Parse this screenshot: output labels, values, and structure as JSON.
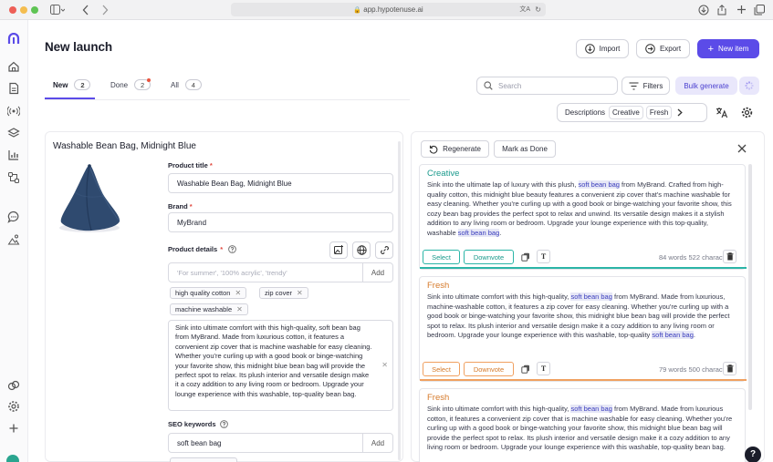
{
  "browser": {
    "url": "app.hypotenuse.ai"
  },
  "header": {
    "title": "New launch",
    "import_label": "Import",
    "export_label": "Export",
    "new_item_label": "New item"
  },
  "tabs": [
    {
      "label": "New",
      "count": "2"
    },
    {
      "label": "Done",
      "count": "2"
    },
    {
      "label": "All",
      "count": "4"
    }
  ],
  "toolbar": {
    "search_placeholder": "Search",
    "filters_label": "Filters",
    "bulk_label": "Bulk generate",
    "descriptions_label": "Descriptions",
    "desc_chip_1": "Creative",
    "desc_chip_2": "Fresh"
  },
  "product": {
    "name": "Washable Bean Bag, Midnight Blue",
    "title_label": "Product title",
    "title_value": "Washable Bean Bag, Midnight Blue",
    "brand_label": "Brand",
    "brand_value": "MyBrand",
    "details_label": "Product details",
    "details_placeholder": "'For summer', '100% acrylic', 'trendy'",
    "add_label": "Add",
    "tags": [
      "high quality cotton",
      "zip cover",
      "machine washable"
    ],
    "description": "Sink into ultimate comfort with this high-quality, soft bean bag from MyBrand. Made from luxurious cotton, it features a convenient zip cover that is machine washable for easy cleaning. Whether you're curling up with a good book or binge-watching your favorite show, this midnight blue bean bag will provide the perfect spot to relax. Its plush interior and versatile design make it a cozy addition to any living room or bedroom. Upgrade your lounge experience with this washable, top-quality bean bag.",
    "seo_label": "SEO keywords",
    "seo_value": "soft bean bag",
    "seo_add_label": "Add",
    "required_mark": "*"
  },
  "panel": {
    "regenerate_label": "Regenerate",
    "mark_done_label": "Mark as Done",
    "cards": [
      {
        "title": "Creative",
        "before": "Sink into the ultimate lap of luxury with this plush, ",
        "keyword": "soft bean bag",
        "middle": " from MyBrand. Crafted from high-quality cotton, this midnight blue beauty features a convenient zip cover that's machine washable for easy cleaning. Whether you're curling up with a good book or binge-watching your favorite show, this cozy bean bag provides the perfect spot to relax and unwind. Its versatile design makes it a stylish addition to any living room or bedroom. Upgrade your lounge experience with this top-quality, washable ",
        "keyword2": "soft bean bag",
        "after": ".",
        "select_label": "Select",
        "downvote_label": "Downvote",
        "stats": "84 words  522 characters"
      },
      {
        "title": "Fresh",
        "before": "Sink into ultimate comfort with this high-quality, ",
        "keyword": "soft bean bag",
        "middle": " from MyBrand. Made from luxurious, machine-washable cotton, it features a zip cover for easy cleaning. Whether you're curling up with a good book or binge-watching your favorite show, this midnight blue bean bag will provide the perfect spot to relax. Its plush interior and versatile design make it a cozy addition to any living room or bedroom. Upgrade your lounge experience with this washable, top-quality ",
        "keyword2": "soft bean bag",
        "after": ".",
        "select_label": "Select",
        "downvote_label": "Downvote",
        "stats": "79 words  500 characters"
      },
      {
        "title": "Fresh",
        "before": "Sink into ultimate comfort with this high-quality, ",
        "keyword": "soft bean bag",
        "middle": " from MyBrand. Made from luxurious cotton, it features a convenient zip cover that is machine washable for easy cleaning. Whether you're curling up with a good book or binge-watching your favorite show, this midnight blue bean bag will provide the perfect spot to relax. Its plush interior and versatile design make it a cozy addition to any living room or bedroom. Upgrade your lounge experience with this washable, top-quality bean bag.",
        "keyword2": "",
        "after": ""
      }
    ]
  },
  "colors": {
    "accent": "#5b4be8",
    "creative": "#1a9a8c",
    "fresh": "#d67a2a"
  },
  "help_label": "?"
}
